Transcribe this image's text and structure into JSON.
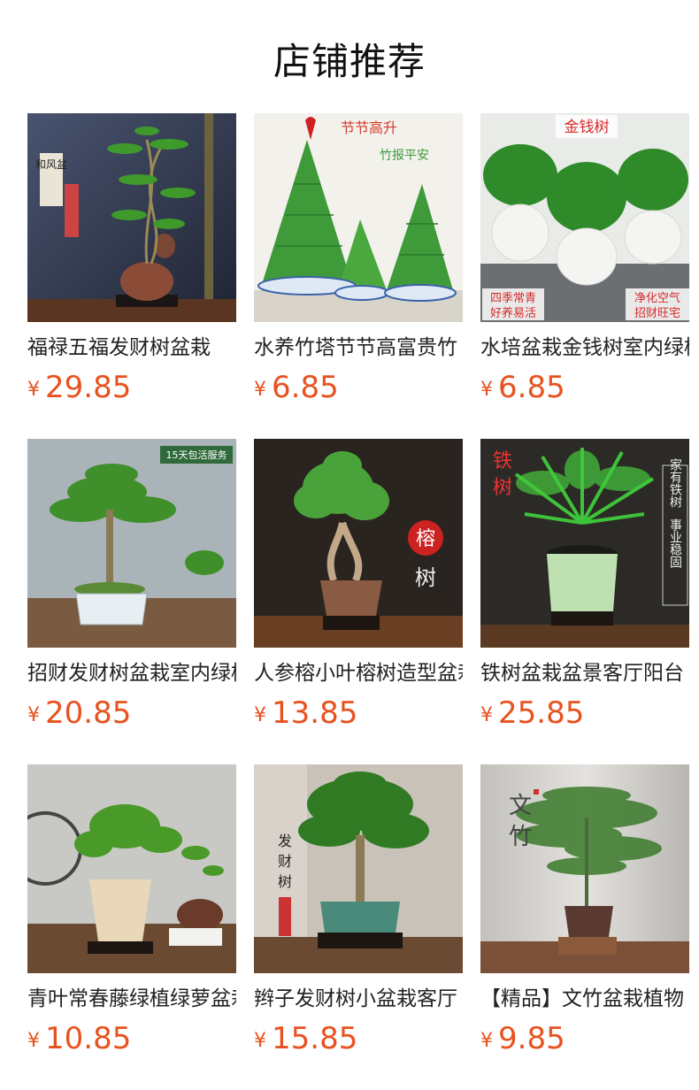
{
  "header": {
    "title": "店铺推荐"
  },
  "currency_symbol": "¥",
  "products": [
    {
      "title": "福禄五福发财树盆栽",
      "price": "29.85",
      "image_text": [
        "和风盆",
        "招财纳福"
      ]
    },
    {
      "title": "水养竹塔节节高富贵竹",
      "price": "6.85",
      "image_text": [
        "节节高升",
        "竹报平安"
      ]
    },
    {
      "title": "水培盆栽金钱树室内绿植",
      "price": "6.85",
      "image_text": [
        "金钱树",
        "四季常青",
        "好养易活",
        "净化空气",
        "招财旺宅"
      ]
    },
    {
      "title": "招财发财树盆栽室内绿植",
      "price": "20.85",
      "image_text": [
        "15天包活服务"
      ]
    },
    {
      "title": "人参榕小叶榕树造型盆栽",
      "price": "13.85",
      "image_text": [
        "榕",
        "树"
      ]
    },
    {
      "title": "铁树盆栽盆景客厅阳台",
      "price": "25.85",
      "image_text": [
        "铁",
        "树",
        "家有铁树",
        "事业稳固"
      ]
    },
    {
      "title": "青叶常春藤绿植绿萝盆栽",
      "price": "10.85",
      "image_text": []
    },
    {
      "title": "辫子发财树小盆栽客厅",
      "price": "15.85",
      "image_text": [
        "发",
        "财",
        "树"
      ]
    },
    {
      "title": "【精品】文竹盆栽植物",
      "price": "9.85",
      "image_text": [
        "文",
        "竹"
      ]
    }
  ]
}
